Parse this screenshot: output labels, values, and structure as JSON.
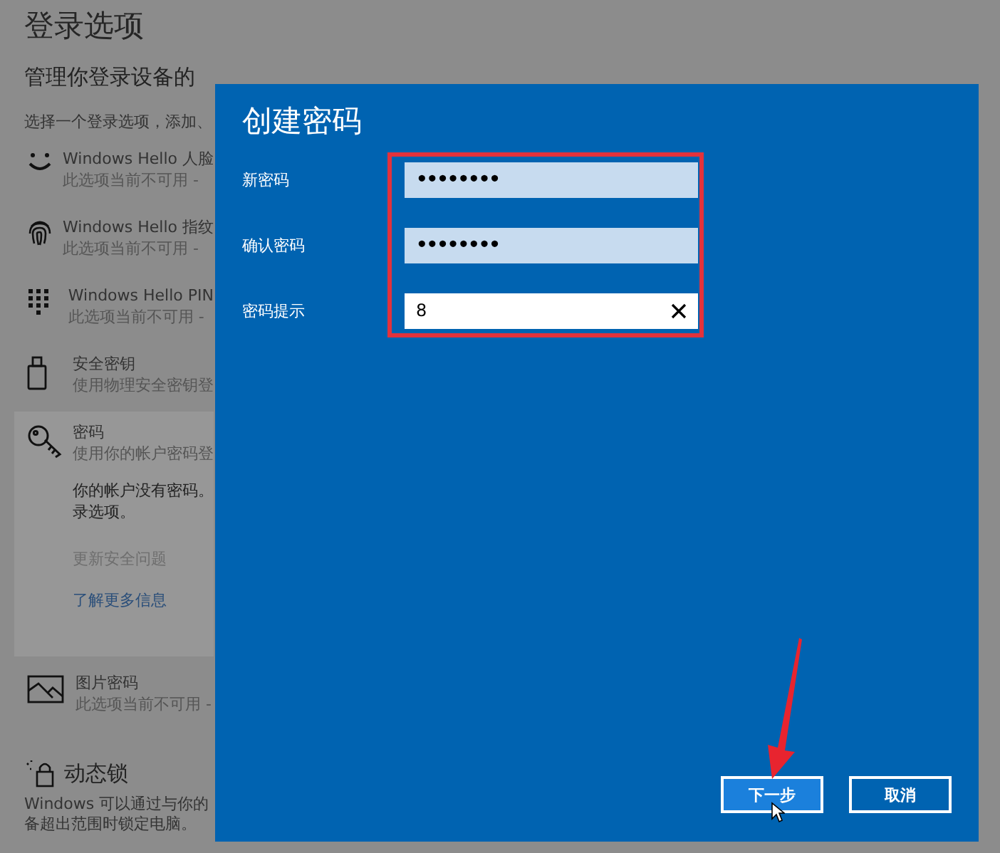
{
  "settings": {
    "title": "登录选项",
    "subtitle": "管理你登录设备的",
    "intro": "选择一个登录选项，添加、",
    "options": [
      {
        "kind": "face",
        "name": "Windows Hello 人脸",
        "status": "此选项当前不可用 -",
        "expanded": false
      },
      {
        "kind": "fingerprint",
        "name": "Windows Hello 指纹",
        "status": "此选项当前不可用 -",
        "expanded": false
      },
      {
        "kind": "pin",
        "name": "Windows Hello PIN",
        "status": "此选项当前不可用 -",
        "expanded": false
      },
      {
        "kind": "key",
        "name": "安全密钥",
        "status": "使用物理安全密钥登",
        "expanded": false
      },
      {
        "kind": "password",
        "name": "密码",
        "status": "使用你的帐户密码登",
        "expanded": true,
        "details": [
          "你的帐户没有密码。",
          "录选项。"
        ],
        "actions": [
          {
            "label": "更新安全问题",
            "disabled": true
          },
          {
            "label": "了解更多信息",
            "disabled": false
          }
        ]
      },
      {
        "kind": "picture",
        "name": "图片密码",
        "status": "此选项当前不可用 -",
        "expanded": false
      }
    ],
    "dynamic_lock": {
      "title": "动态锁",
      "text": [
        "Windows 可以通过与你的",
        "备超出范围时锁定电脑。"
      ]
    }
  },
  "dialog": {
    "title": "创建密码",
    "fields": [
      {
        "label": "新密码",
        "kind": "password",
        "value": "••••••••",
        "focused": false
      },
      {
        "label": "确认密码",
        "kind": "password",
        "value": "••••••••",
        "focused": false
      },
      {
        "label": "密码提示",
        "kind": "text",
        "value": "8",
        "focused": true
      }
    ],
    "buttons": [
      {
        "label": "下一步",
        "primary": true
      },
      {
        "label": "取消",
        "primary": false
      }
    ]
  }
}
